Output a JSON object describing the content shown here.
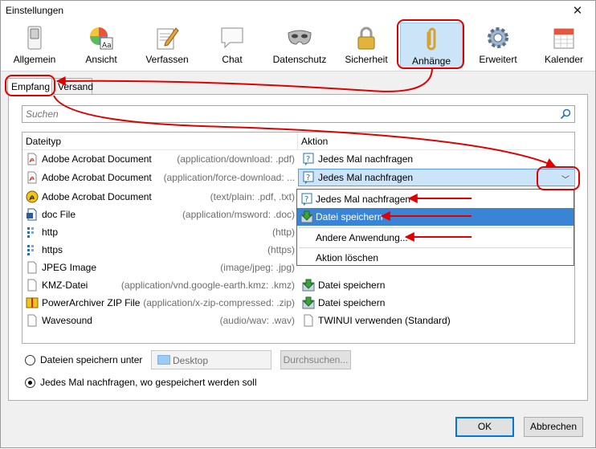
{
  "window": {
    "title": "Einstellungen"
  },
  "toolbar": {
    "items": [
      {
        "label": "Allgemein",
        "icon": "switch-icon"
      },
      {
        "label": "Ansicht",
        "icon": "palette-icon"
      },
      {
        "label": "Verfassen",
        "icon": "compose-icon"
      },
      {
        "label": "Chat",
        "icon": "chat-icon"
      },
      {
        "label": "Datenschutz",
        "icon": "mask-icon"
      },
      {
        "label": "Sicherheit",
        "icon": "lock-icon"
      },
      {
        "label": "Anhänge",
        "icon": "paperclip-icon",
        "active": true
      },
      {
        "label": "Erweitert",
        "icon": "gear-icon"
      },
      {
        "label": "Kalender",
        "icon": "calendar-icon"
      }
    ]
  },
  "tabs": [
    {
      "label": "Empfang",
      "selected": true
    },
    {
      "label": "Versand"
    }
  ],
  "search": {
    "placeholder": "Suchen"
  },
  "list": {
    "columns": {
      "type": "Dateityp",
      "action": "Aktion"
    },
    "rows": [
      {
        "name": "Adobe Acrobat Document",
        "mime": "(application/download: .pdf)",
        "icon": "pdf-icon",
        "action": "Jedes Mal nachfragen",
        "action_icon": "ask-icon"
      },
      {
        "name": "Adobe Acrobat Document",
        "mime": "(application/force-download: ...",
        "icon": "pdf-icon",
        "action": "Jedes Mal nachfragen",
        "action_icon": "ask-icon",
        "selected": true
      },
      {
        "name": "Adobe Acrobat Document",
        "mime": "(text/plain: .pdf, .txt)",
        "icon": "acrobat-icon",
        "action": "",
        "action_icon": ""
      },
      {
        "name": "doc File",
        "mime": "(application/msword: .doc)",
        "icon": "word-icon",
        "action": "",
        "action_icon": ""
      },
      {
        "name": "http",
        "mime": "(http)",
        "icon": "protocol-icon",
        "action": "",
        "action_icon": ""
      },
      {
        "name": "https",
        "mime": "(https)",
        "icon": "protocol-icon",
        "action": "",
        "action_icon": ""
      },
      {
        "name": "JPEG Image",
        "mime": "(image/jpeg: .jpg)",
        "icon": "file-icon",
        "action": "",
        "action_icon": ""
      },
      {
        "name": "KMZ-Datei",
        "mime": "(application/vnd.google-earth.kmz: .kmz)",
        "icon": "file-icon",
        "action": "Datei speichern",
        "action_icon": "save-icon"
      },
      {
        "name": "PowerArchiver ZIP File",
        "mime": "(application/x-zip-compressed: .zip)",
        "icon": "archive-icon",
        "action": "Datei speichern",
        "action_icon": "save-icon"
      },
      {
        "name": "Wavesound",
        "mime": "(audio/wav: .wav)",
        "icon": "file-icon",
        "action": "TWINUI verwenden (Standard)",
        "action_icon": "file-icon"
      }
    ]
  },
  "dropdown": {
    "items": [
      {
        "label": "Jedes Mal nachfragen",
        "icon": "ask-icon"
      },
      {
        "label": "Datei speichern",
        "icon": "save-icon",
        "highlighted": true
      },
      {
        "label": "Andere Anwendung...",
        "icon": ""
      },
      {
        "label": "Aktion löschen",
        "icon": ""
      }
    ]
  },
  "save_options": {
    "save_to_label": "Dateien speichern unter",
    "directory": "Desktop",
    "browse_label": "Durchsuchen...",
    "ask_label": "Jedes Mal nachfragen, wo gespeichert werden soll",
    "selected": "ask"
  },
  "buttons": {
    "ok": "OK",
    "cancel": "Abbrechen"
  },
  "colors": {
    "annotation": "#e00000",
    "selection": "#cce4f7",
    "highlight": "#3a84d6"
  }
}
